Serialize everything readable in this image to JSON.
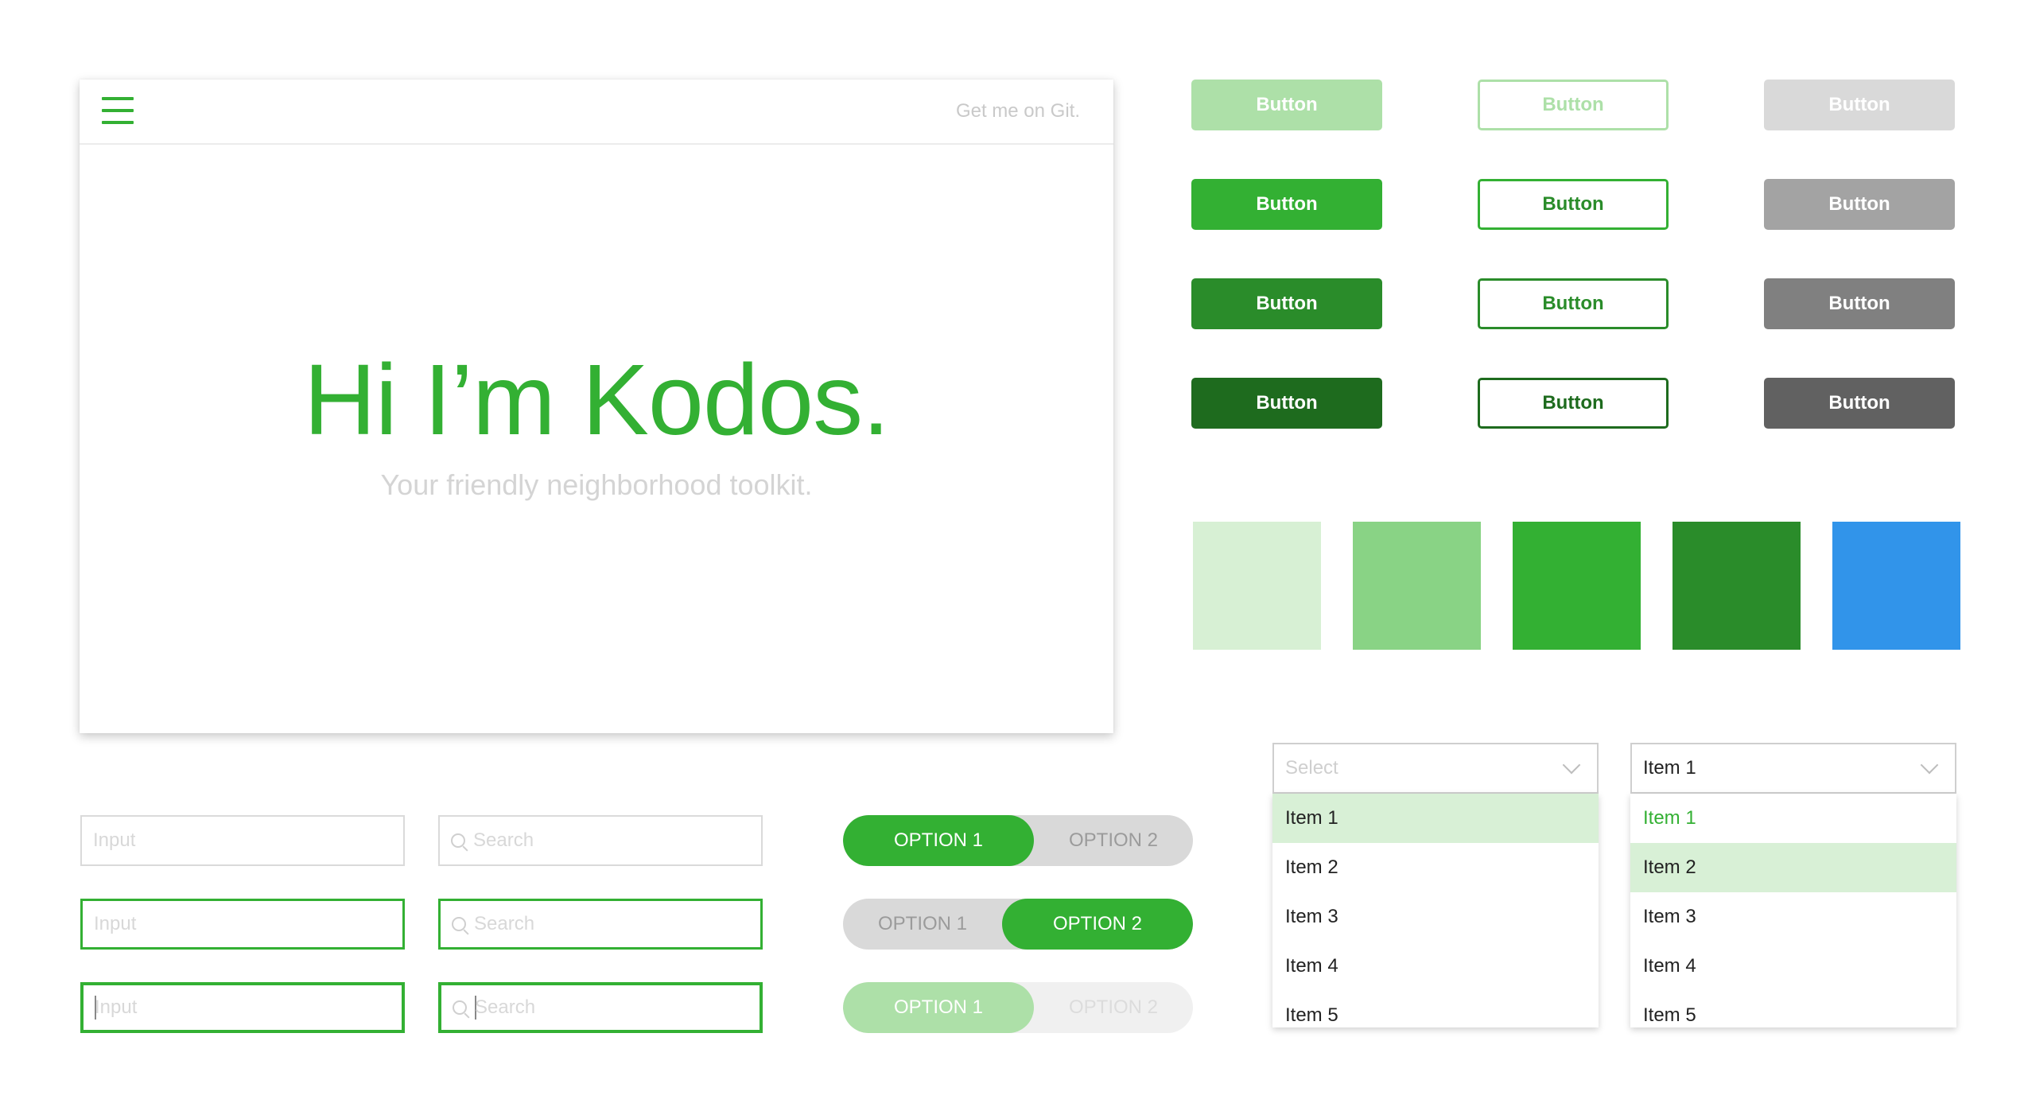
{
  "hero": {
    "git_link": "Get me on Git.",
    "title": "Hi I’m Kodos.",
    "subtitle": "Your friendly neighborhood toolkit."
  },
  "buttons": {
    "filled": [
      "Button",
      "Button",
      "Button",
      "Button"
    ],
    "outline": [
      "Button",
      "Button",
      "Button",
      "Button"
    ],
    "gray": [
      "Button",
      "Button",
      "Button",
      "Button"
    ]
  },
  "swatches": [
    "#d7f0d4",
    "#89d385",
    "#33b033",
    "#2a8c2a",
    "#3194ea"
  ],
  "inputs": {
    "input_placeholder": "Input",
    "search_placeholder": "Search"
  },
  "toggles": [
    {
      "option1": "OPTION 1",
      "option2": "OPTION 2",
      "active": "option1",
      "state": "default"
    },
    {
      "option1": "OPTION 1",
      "option2": "OPTION 2",
      "active": "option2",
      "state": "default"
    },
    {
      "option1": "OPTION 1",
      "option2": "OPTION 2",
      "active": "option1",
      "state": "disabled"
    }
  ],
  "dropdowns": [
    {
      "value": "Select",
      "items": [
        "Item 1",
        "Item 2",
        "Item 3",
        "Item 4",
        "Item 5"
      ],
      "hover_item": "Item 1"
    },
    {
      "value": "Item 1",
      "items": [
        "Item 1",
        "Item 2",
        "Item 3",
        "Item 4",
        "Item 5"
      ],
      "selected_item": "Item 1",
      "hover_item": "Item 2"
    }
  ],
  "colors": {
    "primary": "#33b033",
    "primary_light": "#ade0a8",
    "primary_dark": "#2a8c2a",
    "primary_darker": "#1e6b1e",
    "blue": "#3194ea"
  }
}
